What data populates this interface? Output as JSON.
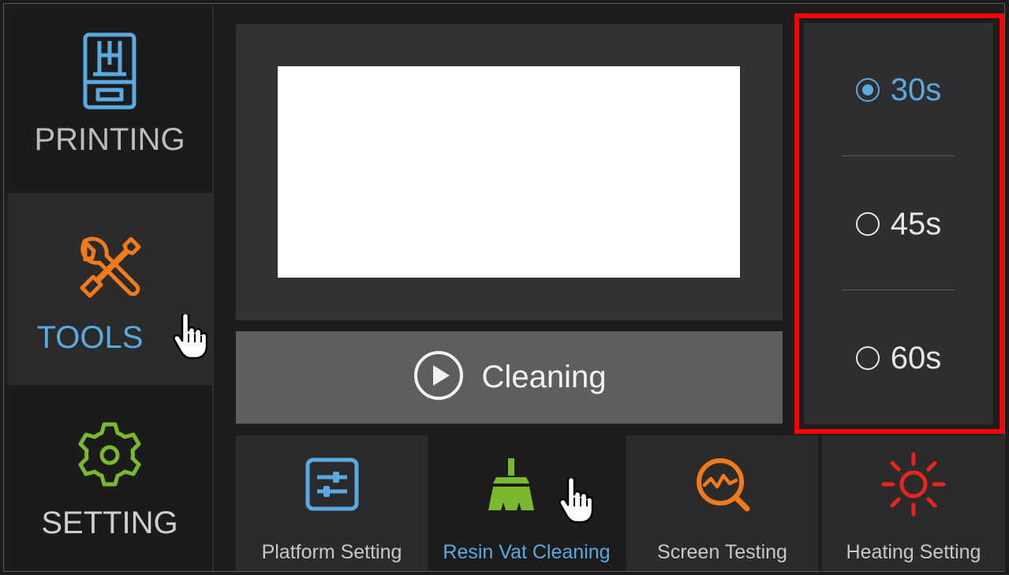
{
  "sidebar": {
    "items": [
      {
        "label": "PRINTING",
        "icon": "printer-icon",
        "color": "#5aa9e0",
        "label_color": "#bdbdbd"
      },
      {
        "label": "TOOLS",
        "icon": "tools-icon",
        "color": "#f07a1c",
        "label_color": "#5aa9e0",
        "active": true
      },
      {
        "label": "SETTING",
        "icon": "gear-icon",
        "color": "#7ab82e",
        "label_color": "#cfcfcf"
      }
    ]
  },
  "main": {
    "action_button": {
      "label": "Cleaning",
      "icon": "play-icon"
    }
  },
  "time_options": [
    {
      "label": "30s",
      "selected": true
    },
    {
      "label": "45s",
      "selected": false
    },
    {
      "label": "60s",
      "selected": false
    }
  ],
  "toolbar": {
    "items": [
      {
        "label": "Platform Setting",
        "icon": "sliders-icon",
        "color": "#5aa9e0"
      },
      {
        "label": "Resin Vat Cleaning",
        "icon": "broom-icon",
        "color": "#7ab82e",
        "active": true
      },
      {
        "label": "Screen Testing",
        "icon": "screen-test-icon",
        "color": "#f07a1c"
      },
      {
        "label": "Heating Setting",
        "icon": "sun-icon",
        "color": "#e8241c"
      }
    ]
  },
  "colors": {
    "accent": "#5aa9e0",
    "highlight": "#ff0000"
  }
}
